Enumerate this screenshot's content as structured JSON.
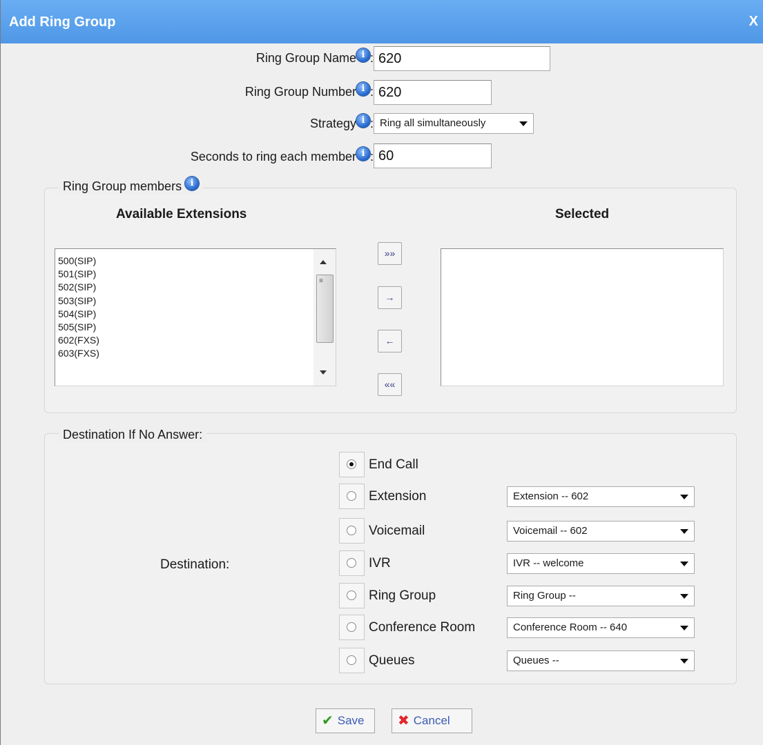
{
  "dialog": {
    "title": "Add Ring Group",
    "close": "X"
  },
  "form": {
    "name": {
      "label": "Ring Group Name",
      "value": "620"
    },
    "number": {
      "label": "Ring Group Number",
      "value": "620"
    },
    "strategy": {
      "label": "Strategy",
      "value": "Ring all simultaneously"
    },
    "seconds": {
      "label": "Seconds to ring each member",
      "value": "60"
    }
  },
  "members": {
    "legend": "Ring Group members",
    "available_title": "Available Extensions",
    "selected_title": "Selected",
    "available": [
      "500(SIP)",
      "501(SIP)",
      "502(SIP)",
      "503(SIP)",
      "504(SIP)",
      "505(SIP)",
      "602(FXS)",
      "603(FXS)"
    ],
    "selected": [],
    "buttons": {
      "add_all": "»»",
      "add": "→",
      "remove": "←",
      "remove_all": "««"
    }
  },
  "destination": {
    "legend": "Destination If No Answer:",
    "label": "Destination:",
    "options": [
      {
        "label": "End Call",
        "checked": true,
        "select": null
      },
      {
        "label": "Extension",
        "checked": false,
        "select": "Extension -- 602"
      },
      {
        "label": "Voicemail",
        "checked": false,
        "select": "Voicemail -- 602"
      },
      {
        "label": "IVR",
        "checked": false,
        "select": "IVR -- welcome"
      },
      {
        "label": "Ring Group",
        "checked": false,
        "select": "Ring Group --"
      },
      {
        "label": "Conference Room",
        "checked": false,
        "select": "Conference Room -- 640"
      },
      {
        "label": "Queues",
        "checked": false,
        "select": "Queues --"
      }
    ]
  },
  "footer": {
    "save": "Save",
    "cancel": "Cancel"
  },
  "colors": {
    "titlebar": "#5aa2ee",
    "info_icon": "#1f63c9",
    "save_icon": "#2f9a22",
    "cancel_icon": "#e2262a"
  }
}
